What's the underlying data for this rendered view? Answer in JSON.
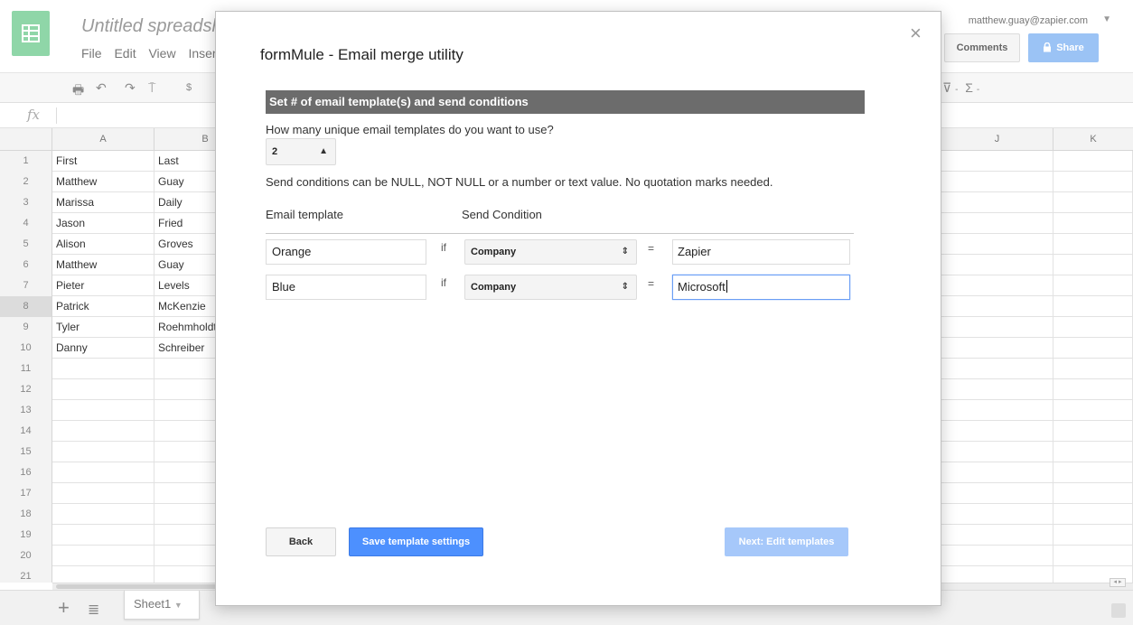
{
  "sheet": {
    "title": "Untitled spreadsheet",
    "menu": [
      "File",
      "Edit",
      "View",
      "Insert"
    ],
    "user_email": "matthew.guay@zapier.com",
    "comments_label": "Comments",
    "share_label": "Share",
    "fx_label": "fx",
    "columns_left": [
      "A",
      "B"
    ],
    "columns_right": [
      "J",
      "K"
    ],
    "row_numbers": [
      "1",
      "2",
      "3",
      "4",
      "5",
      "6",
      "7",
      "8",
      "9",
      "10",
      "11",
      "12",
      "13",
      "14",
      "15",
      "16",
      "17",
      "18",
      "19",
      "20",
      "21"
    ],
    "rows": [
      [
        "First",
        "Last"
      ],
      [
        "Matthew",
        "Guay"
      ],
      [
        "Marissa",
        "Daily"
      ],
      [
        "Jason",
        "Fried"
      ],
      [
        "Alison",
        "Groves"
      ],
      [
        "Matthew",
        "Guay"
      ],
      [
        "Pieter",
        "Levels"
      ],
      [
        "Patrick",
        "McKenzie"
      ],
      [
        "Tyler",
        "Roehmholdt"
      ],
      [
        "Danny",
        "Schreiber"
      ]
    ],
    "sheet_tab": "Sheet1",
    "accent": "#8fd6a8"
  },
  "dialog": {
    "title": "formMule - Email merge utility",
    "section_header": "Set # of email template(s) and send conditions",
    "count_question": "How many unique email templates do you want to use?",
    "template_count": "2",
    "conditions_help": "Send conditions can be NULL, NOT NULL or a number or text value. No quotation marks needed.",
    "col_email_template": "Email template",
    "col_send_condition": "Send Condition",
    "if_label": "if",
    "eq_label": "=",
    "conditions": [
      {
        "template": "Orange",
        "field": "Company",
        "value": "Zapier"
      },
      {
        "template": "Blue",
        "field": "Company",
        "value": "Microsoft"
      }
    ],
    "back_label": "Back",
    "save_label": "Save template settings",
    "next_label": "Next: Edit templates",
    "primary_color": "#4d90fe",
    "disabled_color": "#a6c8fa"
  }
}
